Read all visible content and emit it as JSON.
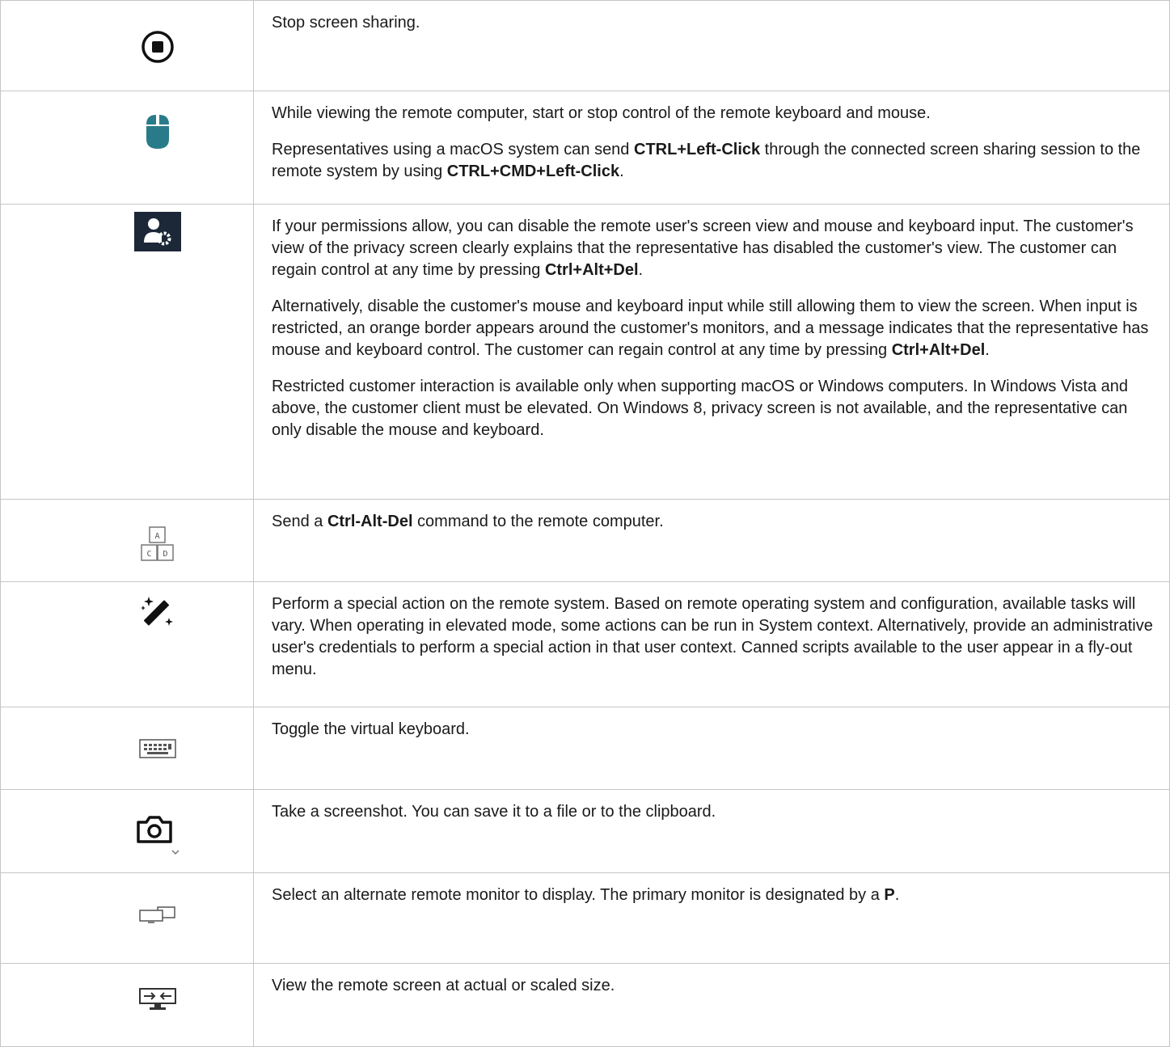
{
  "rows": [
    {
      "icon": "stop-circle-icon",
      "paragraphs": [
        {
          "t1": "Stop screen sharing."
        }
      ]
    },
    {
      "icon": "mouse-icon",
      "paragraphs": [
        {
          "t1": "While viewing the remote computer, start or stop control of the remote keyboard and mouse."
        },
        {
          "t1": "Representatives using a macOS system can send ",
          "b1": "CTRL+Left-Click",
          "t2": " through the connected screen sharing session to the remote system by using ",
          "b2": "CTRL+CMD+Left-Click",
          "t3": "."
        }
      ]
    },
    {
      "icon": "user-settings-icon",
      "paragraphs": [
        {
          "t1": "If your permissions allow, you can disable the remote user's screen view and mouse and keyboard input. The customer's view of the privacy screen clearly explains that the representative has disabled the customer's view. The customer can regain control at any time by pressing ",
          "b1": "Ctrl+Alt+Del",
          "t2": "."
        },
        {
          "t1": "Alternatively, disable the customer's mouse and keyboard input while still allowing them to view the screen. When input is restricted, an orange border appears around the customer's monitors, and a message indicates that the representative has mouse and keyboard control. The customer can regain control at any time by pressing ",
          "b1": "Ctrl+Alt+Del",
          "t2": "."
        },
        {
          "t1": "Restricted customer interaction is available only when supporting macOS or Windows computers. In Windows Vista and above, the customer client must be elevated. On Windows 8, privacy screen is not available, and the representative can only disable the mouse and keyboard."
        }
      ]
    },
    {
      "icon": "ctrl-alt-del-icon",
      "keys": [
        "A",
        "C",
        "D"
      ],
      "paragraphs": [
        {
          "t1": "Send a ",
          "b1": "Ctrl-Alt-Del",
          "t2": " command to the remote computer."
        }
      ]
    },
    {
      "icon": "magic-wand-icon",
      "paragraphs": [
        {
          "t1": "Perform a special action on the remote system. Based on remote operating system and configuration, available tasks will vary. When operating in elevated mode, some actions can be run in System context. Alternatively, provide an administrative user's credentials to perform a special action in that user context. Canned scripts available to the user appear in a fly-out menu."
        }
      ]
    },
    {
      "icon": "keyboard-icon",
      "paragraphs": [
        {
          "t1": "Toggle the virtual keyboard."
        }
      ]
    },
    {
      "icon": "camera-icon",
      "paragraphs": [
        {
          "t1": "Take a screenshot. You can save it to a file or to the clipboard."
        }
      ]
    },
    {
      "icon": "monitors-icon",
      "paragraphs": [
        {
          "t1": "Select an alternate remote monitor to display. The primary monitor is designated by a ",
          "b1": "P",
          "t2": "."
        }
      ]
    },
    {
      "icon": "scale-screen-icon",
      "paragraphs": [
        {
          "t1": "View the remote screen at actual or scaled size."
        }
      ]
    }
  ]
}
